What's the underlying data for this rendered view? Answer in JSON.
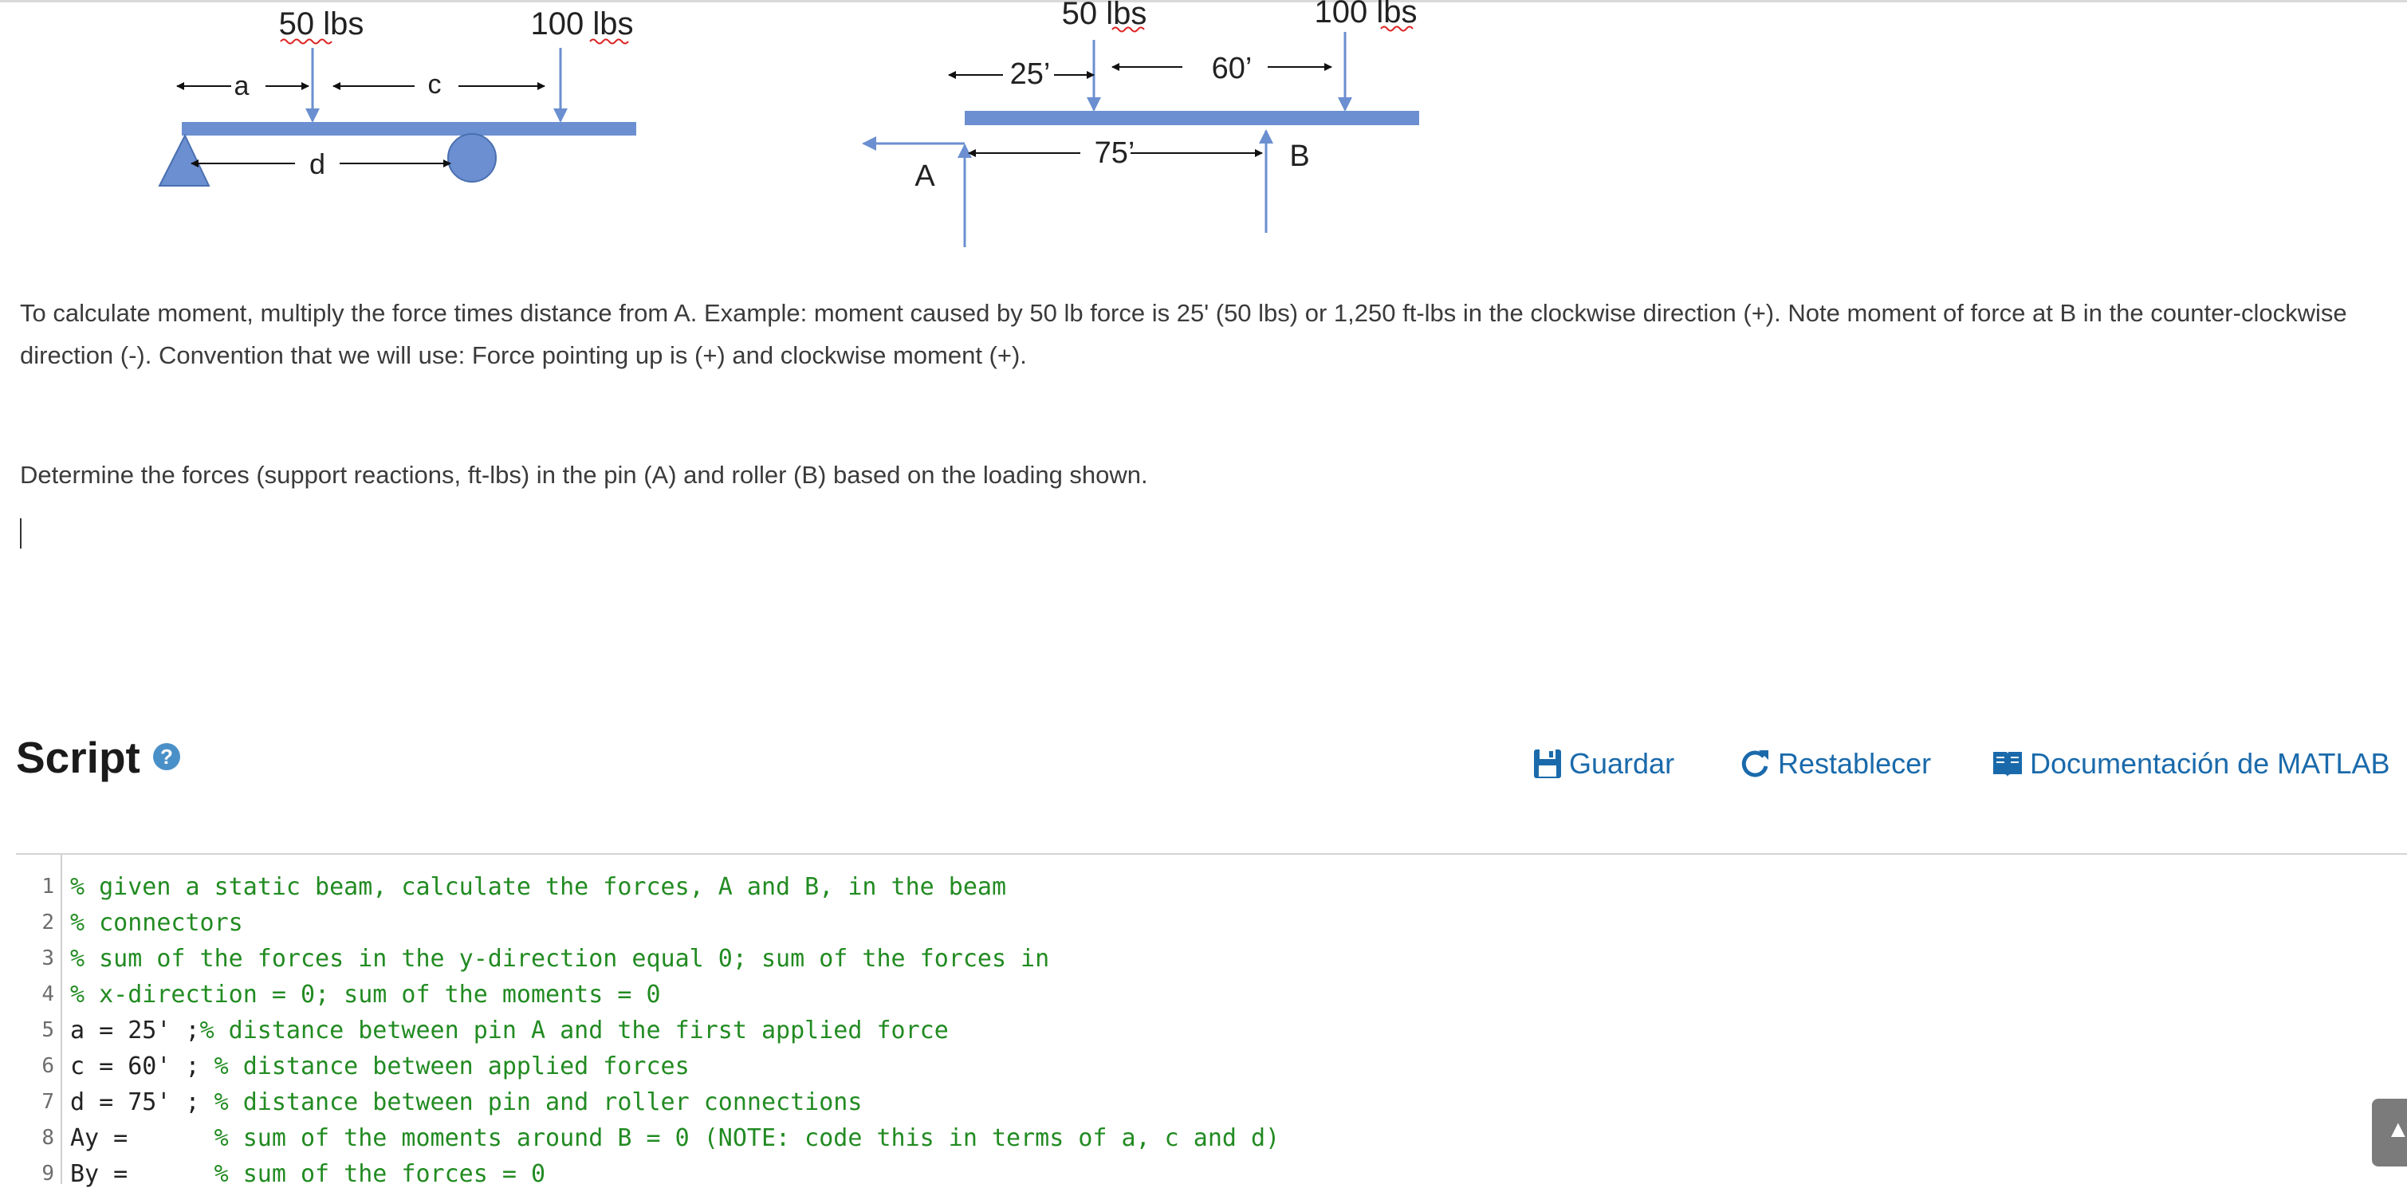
{
  "diagram_left": {
    "force1": "50 lbs",
    "force2": "100 lbs",
    "dim_a": "a",
    "dim_c": "c",
    "dim_d": "d"
  },
  "diagram_right": {
    "force1": "50 lbs",
    "force2": "100 lbs",
    "dim_25": "25’",
    "dim_60": "60’",
    "dim_75": "75’",
    "label_a": "A",
    "label_b": "B"
  },
  "problem": {
    "paragraph1": "To calculate moment, multiply the force times distance from A.  Example: moment caused by 50 lb force is 25' (50 lbs) or 1,250 ft-lbs in the clockwise direction (+). Note moment of force at B in the counter-clockwise direction (-).  Convention that we will use: Force pointing up is (+) and clockwise moment (+).",
    "paragraph2": "Determine the forces (support reactions, ft-lbs) in the pin (A) and roller (B) based on the loading shown."
  },
  "script_header": {
    "title": "Script",
    "help": "?",
    "save_label": "Guardar",
    "reset_label": "Restablecer",
    "docs_label": "Documentación de MATLAB"
  },
  "colors": {
    "accent": "#1a6aab",
    "beam": "#6b8fd0",
    "comment": "#228B22"
  },
  "editor": {
    "lines": [
      {
        "num": "1",
        "code": "",
        "comment": "% given a static beam, calculate the forces, A and B, in the beam"
      },
      {
        "num": "2",
        "code": "",
        "comment": "% connectors"
      },
      {
        "num": "3",
        "code": "",
        "comment": "% sum of the forces in the y-direction equal 0; sum of the forces in"
      },
      {
        "num": "4",
        "code": "",
        "comment": "% x-direction = 0; sum of the moments = 0"
      },
      {
        "num": "5",
        "code": "a = 25' ;",
        "comment": "% distance between pin A and the first applied force"
      },
      {
        "num": "6",
        "code": "c = 60' ; ",
        "comment": "% distance between applied forces"
      },
      {
        "num": "7",
        "code": "d = 75' ; ",
        "comment": "% distance between pin and roller connections"
      },
      {
        "num": "8",
        "code": "Ay =      ",
        "comment": "% sum of the moments around B = 0 (NOTE: code this in terms of a, c and d)"
      },
      {
        "num": "9",
        "code": "By =      ",
        "comment": "% sum of the forces = 0"
      }
    ]
  }
}
